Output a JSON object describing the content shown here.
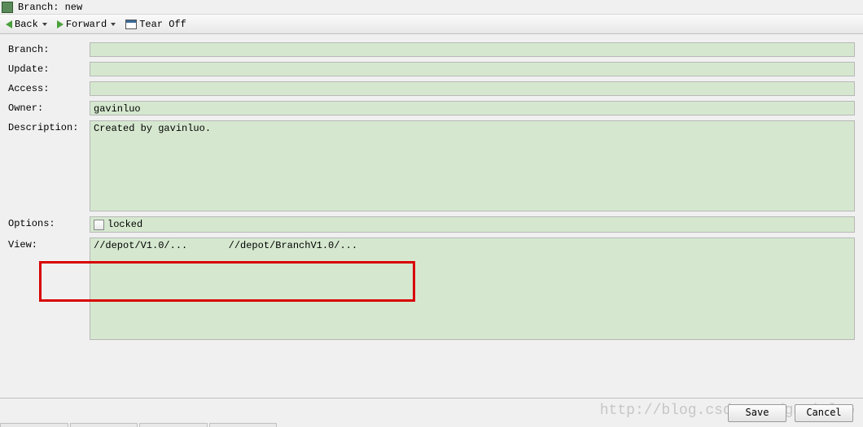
{
  "window": {
    "title": "Branch: new"
  },
  "toolbar": {
    "back": "Back",
    "forward": "Forward",
    "tearoff": "Tear Off"
  },
  "labels": {
    "branch": "Branch:",
    "update": "Update:",
    "access": "Access:",
    "owner": "Owner:",
    "description": "Description:",
    "options": "Options:",
    "view": "View:"
  },
  "fields": {
    "branch": "",
    "update": "",
    "access": "",
    "owner": "gavinluo",
    "description": "Created by gavinluo.",
    "options_locked": "locked",
    "view": "//depot/V1.0/...       //depot/BranchV1.0/..."
  },
  "buttons": {
    "save": "Save",
    "cancel": "Cancel"
  },
  "watermark": "http://blog.csdn.net/gavinluo"
}
